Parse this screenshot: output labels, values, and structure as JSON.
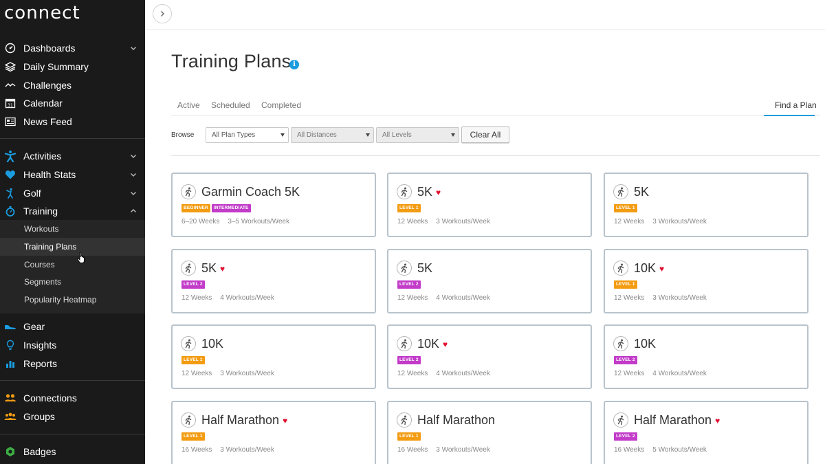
{
  "app": {
    "logo_text": "connect"
  },
  "sidebar": {
    "groups": [
      [
        {
          "label": "Dashboards",
          "icon": "gauge-icon",
          "chevron": "down"
        },
        {
          "label": "Daily Summary",
          "icon": "layers-icon",
          "chevron": ""
        },
        {
          "label": "Challenges",
          "icon": "challenges-icon",
          "chevron": ""
        },
        {
          "label": "Calendar",
          "icon": "calendar-icon",
          "chevron": ""
        },
        {
          "label": "News Feed",
          "icon": "news-icon",
          "chevron": ""
        }
      ],
      [
        {
          "label": "Activities",
          "icon": "activity-person-icon",
          "chevron": "down"
        },
        {
          "label": "Health Stats",
          "icon": "heart-icon",
          "chevron": "down"
        },
        {
          "label": "Golf",
          "icon": "golf-icon",
          "chevron": "down"
        },
        {
          "label": "Training",
          "icon": "stopwatch-icon",
          "chevron": "up"
        }
      ],
      [
        {
          "label": "Gear",
          "icon": "shoe-icon",
          "chevron": ""
        },
        {
          "label": "Insights",
          "icon": "lightbulb-icon",
          "chevron": ""
        },
        {
          "label": "Reports",
          "icon": "bar-chart-icon",
          "chevron": ""
        }
      ],
      [
        {
          "label": "Connections",
          "icon": "connections-icon",
          "chevron": ""
        },
        {
          "label": "Groups",
          "icon": "groups-icon",
          "chevron": ""
        }
      ],
      [
        {
          "label": "Badges",
          "icon": "badge-icon",
          "chevron": ""
        }
      ]
    ],
    "training_sub": [
      {
        "label": "Workouts",
        "active": false
      },
      {
        "label": "Training Plans",
        "active": true
      },
      {
        "label": "Courses",
        "active": false
      },
      {
        "label": "Segments",
        "active": false
      },
      {
        "label": "Popularity Heatmap",
        "active": false
      }
    ]
  },
  "page": {
    "title": "Training Plans",
    "info_glyph": "i",
    "tabs": {
      "active": "Active",
      "scheduled": "Scheduled",
      "completed": "Completed",
      "find": "Find a Plan"
    },
    "filters": {
      "browse_label": "Browse",
      "plan_type": "All Plan Types",
      "distance": "All Distances",
      "level": "All Levels",
      "clear_label": "Clear All"
    }
  },
  "colors": {
    "accent": "#1a9cdf",
    "level1": "#f39c12",
    "level2": "#c23bc9",
    "heart": "#e0102f",
    "sidebar_bg": "#1a1a1a"
  },
  "cards": [
    {
      "title": "Garmin Coach 5K",
      "favorite": false,
      "badges": [
        {
          "text": "BEGINNER",
          "color": "orange"
        },
        {
          "text": "INTERMEDIATE",
          "color": "purple"
        }
      ],
      "weeks": "6–20 Weeks",
      "workouts": "3–5 Workouts/Week"
    },
    {
      "title": "5K",
      "favorite": true,
      "badges": [
        {
          "text": "LEVEL 1",
          "color": "orange"
        }
      ],
      "weeks": "12 Weeks",
      "workouts": "3 Workouts/Week"
    },
    {
      "title": "5K",
      "favorite": false,
      "badges": [
        {
          "text": "LEVEL 1",
          "color": "orange"
        }
      ],
      "weeks": "12 Weeks",
      "workouts": "3 Workouts/Week"
    },
    {
      "title": "5K",
      "favorite": true,
      "badges": [
        {
          "text": "LEVEL 2",
          "color": "purple"
        }
      ],
      "weeks": "12 Weeks",
      "workouts": "4 Workouts/Week"
    },
    {
      "title": "5K",
      "favorite": false,
      "badges": [
        {
          "text": "LEVEL 2",
          "color": "purple"
        }
      ],
      "weeks": "12 Weeks",
      "workouts": "4 Workouts/Week"
    },
    {
      "title": "10K",
      "favorite": true,
      "badges": [
        {
          "text": "LEVEL 1",
          "color": "orange"
        }
      ],
      "weeks": "12 Weeks",
      "workouts": "3 Workouts/Week"
    },
    {
      "title": "10K",
      "favorite": false,
      "badges": [
        {
          "text": "LEVEL 1",
          "color": "orange"
        }
      ],
      "weeks": "12 Weeks",
      "workouts": "3 Workouts/Week"
    },
    {
      "title": "10K",
      "favorite": true,
      "badges": [
        {
          "text": "LEVEL 2",
          "color": "purple"
        }
      ],
      "weeks": "12 Weeks",
      "workouts": "4 Workouts/Week"
    },
    {
      "title": "10K",
      "favorite": false,
      "badges": [
        {
          "text": "LEVEL 2",
          "color": "purple"
        }
      ],
      "weeks": "12 Weeks",
      "workouts": "4 Workouts/Week"
    },
    {
      "title": "Half Marathon",
      "favorite": true,
      "badges": [
        {
          "text": "LEVEL 1",
          "color": "orange"
        }
      ],
      "weeks": "16 Weeks",
      "workouts": "3 Workouts/Week"
    },
    {
      "title": "Half Marathon",
      "favorite": false,
      "badges": [
        {
          "text": "LEVEL 1",
          "color": "orange"
        }
      ],
      "weeks": "16 Weeks",
      "workouts": "3 Workouts/Week"
    },
    {
      "title": "Half Marathon",
      "favorite": true,
      "badges": [
        {
          "text": "LEVEL 2",
          "color": "purple"
        }
      ],
      "weeks": "16 Weeks",
      "workouts": "5 Workouts/Week"
    }
  ]
}
